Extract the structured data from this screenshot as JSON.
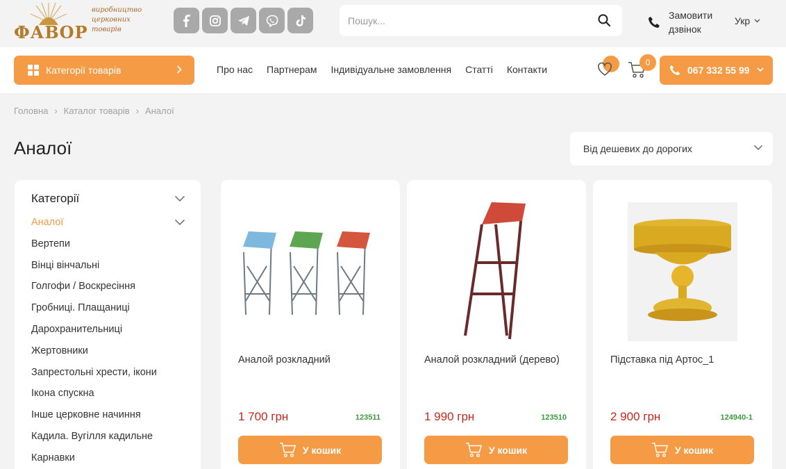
{
  "brand": {
    "logo_word": "ФАВОР",
    "tagline": [
      "виробництво",
      "церковних",
      "товарів"
    ]
  },
  "header": {
    "socials": [
      "facebook-icon",
      "instagram-icon",
      "telegram-icon",
      "viber-icon",
      "tiktok-icon"
    ],
    "search_placeholder": "Пошук...",
    "callback_label_1": "Замовити",
    "callback_label_2": "дзвінок",
    "language": "Укр"
  },
  "nav": {
    "categories_label": "Категорії товарів",
    "menu": [
      "Про нас",
      "Партнерам",
      "Індивідуальне замовлення",
      "Статті",
      "Контакти"
    ],
    "cart_count": "0",
    "phone": "067 332 55 99"
  },
  "breadcrumb": [
    "Головна",
    "Каталог товарів",
    "Аналої"
  ],
  "page_title": "Аналої",
  "sort_label": "Від дешевих до дорогих",
  "sidebar": {
    "title": "Категорії",
    "items": [
      "Аналої",
      "Вертепи",
      "Вінці вінчальні",
      "Голгофи / Воскресіння",
      "Гробниці. Плащаниці",
      "Дарохранительниці",
      "Жертовники",
      "Запрестольні хрести, ікони",
      "Ікона спускна",
      "Інше церковне начиння",
      "Кадила. Вугілля кадильне",
      "Карнавки"
    ]
  },
  "products": [
    {
      "name": "Аналой розкладний",
      "price": "1 700 грн",
      "code": "123511",
      "buy": "У кошик"
    },
    {
      "name": "Аналой розкладний (дерево)",
      "price": "1 990 грн",
      "code": "123510",
      "buy": "У кошик"
    },
    {
      "name": "Підставка під Артос_1",
      "price": "2 900 грн",
      "code": "124940-1",
      "buy": "У кошик"
    }
  ],
  "colors": {
    "accent": "#f59b45",
    "price": "#c8281e",
    "code": "#3d9b3d"
  }
}
